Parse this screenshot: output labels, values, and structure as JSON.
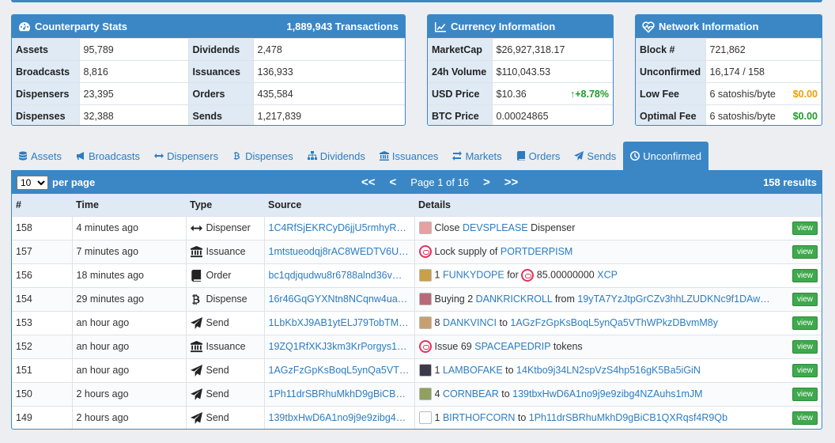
{
  "stats": {
    "title": "Counterparty Stats",
    "transactions": "1,889,943 Transactions",
    "rows": [
      {
        "k1": "Assets",
        "v1": "95,789",
        "k2": "Dividends",
        "v2": "2,478"
      },
      {
        "k1": "Broadcasts",
        "v1": "8,816",
        "k2": "Issuances",
        "v2": "136,933"
      },
      {
        "k1": "Dispensers",
        "v1": "23,395",
        "k2": "Orders",
        "v2": "435,584"
      },
      {
        "k1": "Dispenses",
        "v1": "32,388",
        "k2": "Sends",
        "v2": "1,217,839"
      }
    ]
  },
  "currency": {
    "title": "Currency Information",
    "rows": [
      {
        "k": "MarketCap",
        "v": "$26,927,318.17",
        "extra": ""
      },
      {
        "k": "24h Volume",
        "v": "$110,043.53",
        "extra": ""
      },
      {
        "k": "USD Price",
        "v": "$10.36",
        "extra": "+8.78%"
      },
      {
        "k": "BTC Price",
        "v": "0.00024865",
        "extra": ""
      }
    ]
  },
  "network": {
    "title": "Network Information",
    "rows": [
      {
        "k": "Block #",
        "v": "721,862",
        "extra": ""
      },
      {
        "k": "Unconfirmed",
        "v": "16,174 / 158",
        "extra": ""
      },
      {
        "k": "Low Fee",
        "v": "6 satoshis/byte",
        "extra": "$0.00"
      },
      {
        "k": "Optimal Fee",
        "v": "6 satoshis/byte",
        "extra": "$0.00"
      }
    ]
  },
  "tabs": [
    {
      "label": "Assets",
      "icon": "database-icon"
    },
    {
      "label": "Broadcasts",
      "icon": "bullhorn-icon"
    },
    {
      "label": "Dispensers",
      "icon": "arrows-h-icon"
    },
    {
      "label": "Dispenses",
      "icon": "bitcoin-icon"
    },
    {
      "label": "Dividends",
      "icon": "sitemap-icon"
    },
    {
      "label": "Issuances",
      "icon": "bank-icon"
    },
    {
      "label": "Markets",
      "icon": "exchange-icon"
    },
    {
      "label": "Orders",
      "icon": "book-icon"
    },
    {
      "label": "Sends",
      "icon": "paper-plane-icon"
    },
    {
      "label": "Unconfirmed",
      "icon": "clock-icon"
    }
  ],
  "table": {
    "per_page_value": "10",
    "per_page_label": "per page",
    "page_label": "Page 1 of 16",
    "results": "158 results",
    "first_label": "<<",
    "prev_label": "<",
    "next_label": ">",
    "last_label": ">>",
    "columns": [
      "#",
      "Time",
      "Type",
      "Source",
      "Details"
    ],
    "view_label": "view",
    "rows": [
      {
        "id": "158",
        "time": "4 minutes ago",
        "type": "Dispenser",
        "source": "1C4RfSjEKRCyD6jjU5rmhyR…",
        "d": [
          [
            "t",
            "Close "
          ],
          [
            "l",
            "DEVSPLEASE"
          ],
          [
            "t",
            " Dispenser"
          ]
        ],
        "thumb": "#e8a0a0"
      },
      {
        "id": "157",
        "time": "7 minutes ago",
        "type": "Issuance",
        "source": "1mtstueodqj8rAC8WEDTV6U…",
        "d": [
          [
            "t",
            "Lock supply of "
          ],
          [
            "l",
            "PORTDERPISM"
          ]
        ],
        "thumb": "ring"
      },
      {
        "id": "156",
        "time": "18 minutes ago",
        "type": "Order",
        "source": "bc1qdjqudwu8r6788alnd36v…",
        "d": [
          [
            "t",
            "1 "
          ],
          [
            "l",
            "FUNKYDOPE"
          ],
          [
            "t",
            " for "
          ],
          [
            "r",
            ""
          ],
          [
            "t",
            " 85.00000000 "
          ],
          [
            "l",
            "XCP"
          ]
        ],
        "thumb": "#c9a04a"
      },
      {
        "id": "154",
        "time": "29 minutes ago",
        "type": "Dispense",
        "source": "16r46GqGYXNtn8NCqnw4ua…",
        "d": [
          [
            "t",
            "Buying 2 "
          ],
          [
            "l",
            "DANKRICKROLL"
          ],
          [
            "t",
            " from "
          ],
          [
            "l",
            "19yTA7YzJtpGrCZv3hhLZUDKNc9f1DAw…"
          ]
        ],
        "thumb": "#b86a7a"
      },
      {
        "id": "153",
        "time": "an hour ago",
        "type": "Send",
        "source": "1LbKbXJ9AB1ytELJ79TobTM…",
        "d": [
          [
            "t",
            "8 "
          ],
          [
            "l",
            "DANKVINCI"
          ],
          [
            "t",
            " to "
          ],
          [
            "l",
            "1AGzFzGpKsBoqL5ynQa5VThWPkzDBvmM8y"
          ]
        ],
        "thumb": "#c8a070"
      },
      {
        "id": "152",
        "time": "an hour ago",
        "type": "Issuance",
        "source": "19ZQ1RfXKJ3km3KrPorgys1…",
        "d": [
          [
            "t",
            "Issue 69 "
          ],
          [
            "l",
            "SPACEAPEDRIP"
          ],
          [
            "t",
            " tokens"
          ]
        ],
        "thumb": "ring"
      },
      {
        "id": "151",
        "time": "an hour ago",
        "type": "Send",
        "source": "1AGzFzGpKsBoqL5ynQa5VT…",
        "d": [
          [
            "t",
            "1 "
          ],
          [
            "l",
            "LAMBOFAKE"
          ],
          [
            "t",
            " to "
          ],
          [
            "l",
            "14Ktbo9j34LN2spVzS4hp516gK5Ba5iGiN"
          ]
        ],
        "thumb": "#3a3a4a"
      },
      {
        "id": "150",
        "time": "2 hours ago",
        "type": "Send",
        "source": "1Ph11drSBRhuMkhD9gBiCB…",
        "d": [
          [
            "t",
            "4 "
          ],
          [
            "l",
            "CORNBEAR"
          ],
          [
            "t",
            " to "
          ],
          [
            "l",
            "139tbxHwD6A1no9j9e9zibg4NZAuhs1mJM"
          ]
        ],
        "thumb": "#8fa060"
      },
      {
        "id": "149",
        "time": "2 hours ago",
        "type": "Send",
        "source": "139tbxHwD6A1no9j9e9zibg4…",
        "d": [
          [
            "t",
            "1 "
          ],
          [
            "l",
            "BIRTHOFCORN"
          ],
          [
            "t",
            " to "
          ],
          [
            "l",
            "1Ph11drSBRhuMkhD9gBiCB1QXRqsf4R9Qb"
          ]
        ],
        "thumb": "#ffffff"
      }
    ]
  },
  "colors": {
    "brand": "#3b87c6",
    "link": "#2b7cc2",
    "up": "#1e9a2a",
    "fee_low": "#f0a000",
    "fee_opt": "#1e9a2a",
    "view_btn": "#3fa94d"
  }
}
